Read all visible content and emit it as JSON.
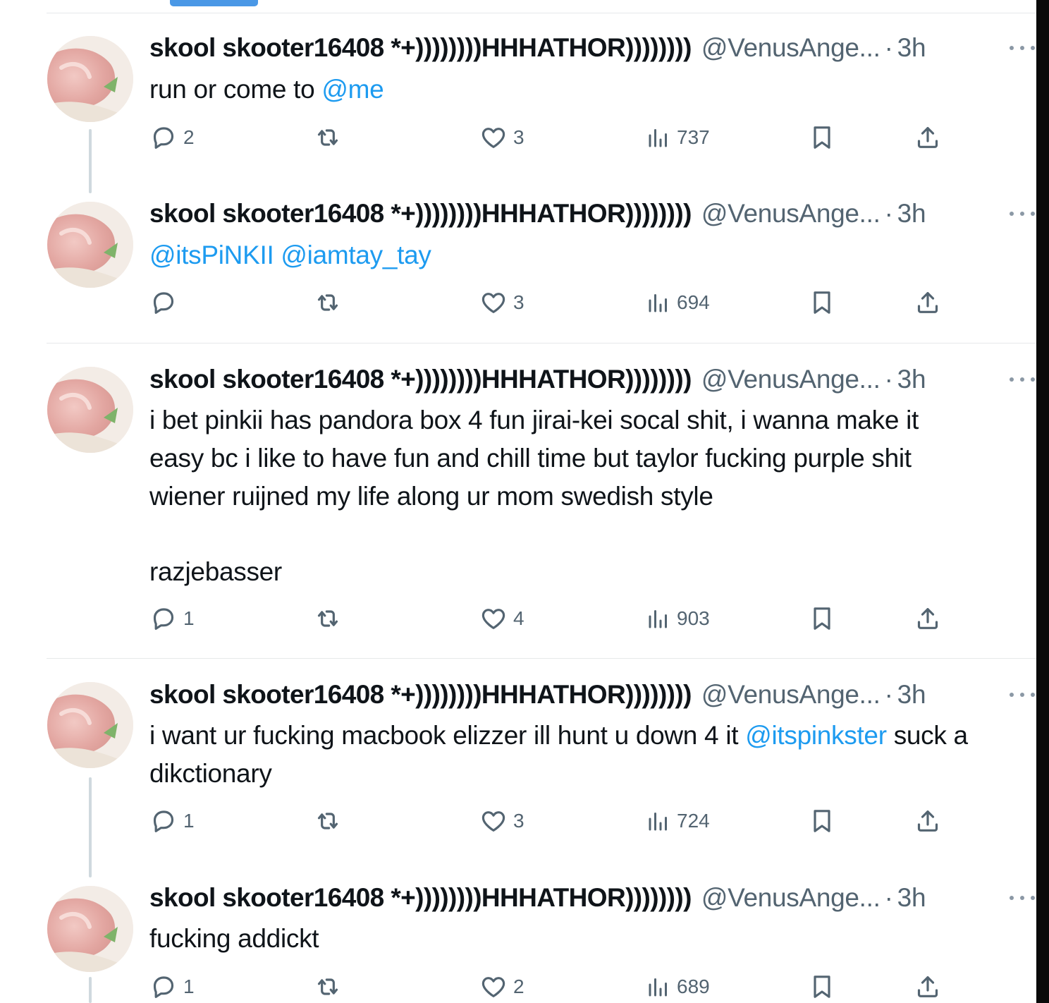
{
  "author": {
    "name": "skool skooter16408 *+))))))))HHHATHOR))))))))",
    "handle": "@VenusAnge...",
    "dot": "·",
    "time": "3h"
  },
  "tweets": [
    {
      "text_parts": [
        {
          "t": "run or come to ",
          "m": false
        },
        {
          "t": "@me",
          "m": true
        }
      ],
      "counts": {
        "reply": "2",
        "retweet": "",
        "like": "3",
        "views": "737"
      }
    },
    {
      "text_parts": [
        {
          "t": "@itsPiNKII",
          "m": true
        },
        {
          "t": " ",
          "m": false
        },
        {
          "t": "@iamtay_tay",
          "m": true
        }
      ],
      "counts": {
        "reply": "",
        "retweet": "",
        "like": "3",
        "views": "694"
      }
    },
    {
      "text_lines": [
        "i bet pinkii has pandora box 4 fun jirai-kei socal shit,  i wanna make it",
        "easy bc i like to have fun and chill time but taylor fucking purple shit",
        "wiener ruijned my life along ur mom swedish style",
        "",
        "razjebasser"
      ],
      "counts": {
        "reply": "1",
        "retweet": "",
        "like": "4",
        "views": "903"
      }
    },
    {
      "text_parts": [
        {
          "t": "i want ur fucking macbook elizzer ill hunt u down 4 it ",
          "m": false
        },
        {
          "t": "@itspinkster",
          "m": true
        },
        {
          "t": " suck a dikctionary",
          "m": false
        }
      ],
      "counts": {
        "reply": "1",
        "retweet": "",
        "like": "3",
        "views": "724"
      }
    },
    {
      "text_parts": [
        {
          "t": "fucking addickt",
          "m": false
        }
      ],
      "counts": {
        "reply": "1",
        "retweet": "",
        "like": "2",
        "views": "689"
      }
    }
  ],
  "icons": {
    "reply": "reply-bubble-icon",
    "retweet": "retweet-arrows-icon",
    "like": "heart-icon",
    "views": "bar-chart-icon",
    "bookmark": "bookmark-icon",
    "share": "share-upload-icon",
    "more": "more-dots-icon"
  },
  "colors": {
    "mention": "#1d9bf0",
    "secondary": "#536471",
    "text": "#0f1419",
    "tab_indicator": "#4a98e6"
  }
}
